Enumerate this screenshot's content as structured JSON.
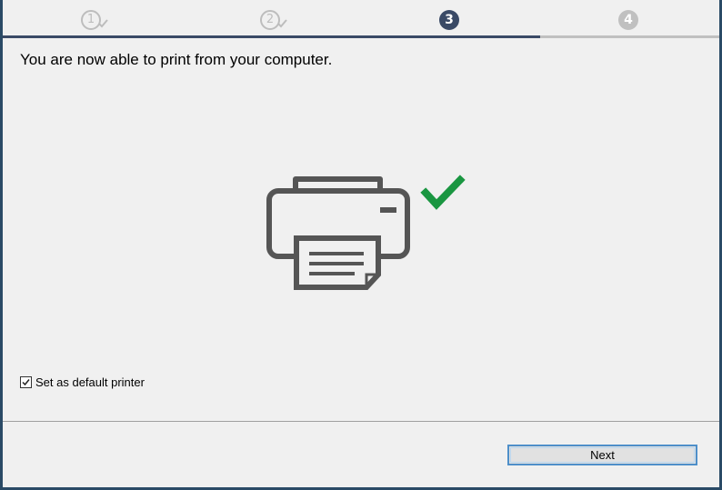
{
  "steps": [
    {
      "label": "1",
      "state": "done"
    },
    {
      "label": "2",
      "state": "done"
    },
    {
      "label": "3",
      "state": "current"
    },
    {
      "label": "4",
      "state": "todo"
    }
  ],
  "colors": {
    "progress_done": "#3a4a66",
    "progress_todo": "#c0c0c0",
    "check_green": "#1a9641",
    "printer_gray": "#555555",
    "button_border": "#4e8fc9"
  },
  "main": {
    "title": "You are now able to print from your computer.",
    "illustration_icons": [
      "printer-icon",
      "checkmark-icon"
    ]
  },
  "options": {
    "default_printer_label": "Set as default printer",
    "default_printer_checked": true
  },
  "footer": {
    "next_label": "Next"
  }
}
